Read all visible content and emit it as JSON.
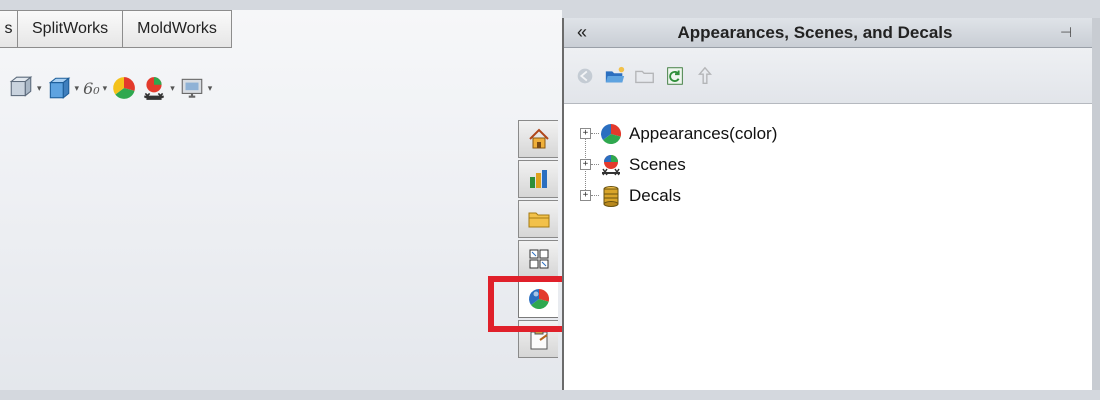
{
  "command_manager": {
    "tabs": [
      {
        "label": "s"
      },
      {
        "label": "SplitWorks"
      },
      {
        "label": "MoldWorks"
      }
    ]
  },
  "hud_toolbar": {
    "items": [
      "view-orientation-icon",
      "display-style-icon",
      "hide-show-items-icon",
      "edit-appearance-icon",
      "apply-scene-icon",
      "view-settings-icon"
    ],
    "arrow": "▾",
    "hide_show_glyph": "6₀"
  },
  "task_pane_tabs": [
    {
      "name": "solidworks-resources",
      "icon": "home-icon"
    },
    {
      "name": "design-library",
      "icon": "design-library-icon"
    },
    {
      "name": "file-explorer",
      "icon": "folder-icon"
    },
    {
      "name": "view-palette",
      "icon": "view-palette-icon"
    },
    {
      "name": "appearances-scenes-decals",
      "icon": "appearance-ball-icon",
      "active": true
    },
    {
      "name": "custom-properties",
      "icon": "clipboard-icon"
    }
  ],
  "task_pane": {
    "collapse_label": "«",
    "title": "Appearances, Scenes, and Decals",
    "pin_label": "⊣",
    "toolbar": [
      "back-icon",
      "open-folder-icon",
      "new-folder-icon",
      "refresh-icon",
      "up-icon"
    ],
    "tree": [
      {
        "label": "Appearances(color)",
        "expander": "+",
        "icon": "appearance-ball-icon"
      },
      {
        "label": "Scenes",
        "expander": "+",
        "icon": "scene-icon"
      },
      {
        "label": "Decals",
        "expander": "+",
        "icon": "decal-icon"
      }
    ]
  },
  "colors": {
    "highlight": "#e0202a",
    "panel_header": "#c9ced5",
    "pane_background": "#ffffff"
  }
}
